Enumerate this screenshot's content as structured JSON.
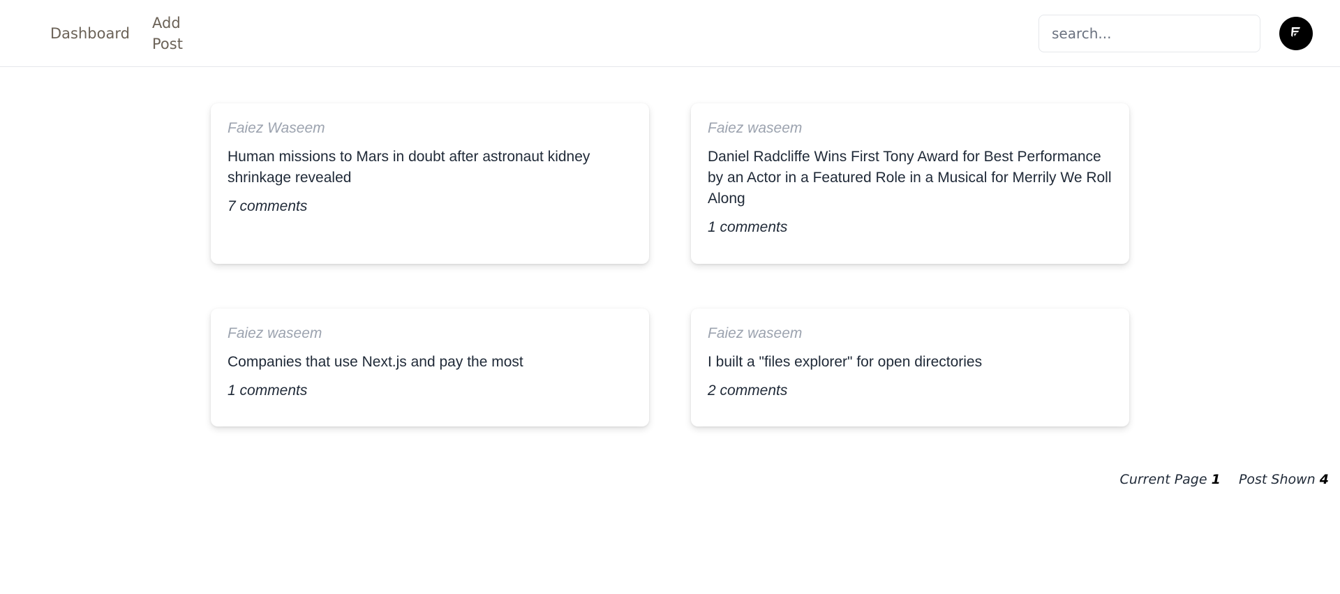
{
  "nav": {
    "dashboard_label": "Dashboard",
    "add_post_label": "Add Post"
  },
  "search": {
    "placeholder": "search...",
    "value": ""
  },
  "avatar": {
    "icon": "logo-f-icon",
    "background": "#000000"
  },
  "posts": [
    {
      "author": "Faiez Waseem",
      "title": "Human missions to Mars in doubt after astronaut kidney shrinkage revealed",
      "comments": "7 comments"
    },
    {
      "author": "Faiez waseem",
      "title": "Daniel Radcliffe Wins First Tony Award for Best Performance by an Actor in a Featured Role in a Musical for Merrily We Roll Along",
      "comments": "1 comments"
    },
    {
      "author": "Faiez waseem",
      "title": "Companies that use Next.js and pay the most",
      "comments": "1 comments"
    },
    {
      "author": "Faiez waseem",
      "title": "I built a \"files explorer\" for open directories",
      "comments": "2 comments"
    }
  ],
  "pagination": {
    "current_page_label": "Current Page",
    "current_page_value": "1",
    "posts_shown_label": "Post Shown",
    "posts_shown_value": "4"
  }
}
